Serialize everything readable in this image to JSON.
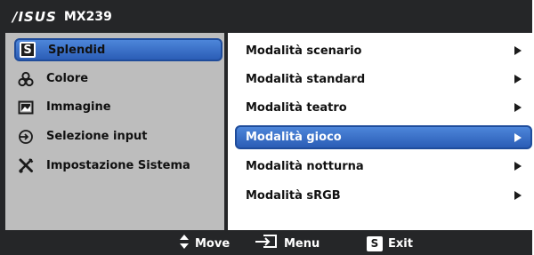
{
  "header": {
    "brand": "/ISUS",
    "model": "MX239"
  },
  "left_menu": {
    "items": [
      {
        "label": "Splendid",
        "icon": "splendid-s-icon",
        "selected": true
      },
      {
        "label": "Colore",
        "icon": "color-icon",
        "selected": false
      },
      {
        "label": "Immagine",
        "icon": "image-icon",
        "selected": false
      },
      {
        "label": "Selezione input",
        "icon": "input-select-icon",
        "selected": false
      },
      {
        "label": "Impostazione Sistema",
        "icon": "tools-icon",
        "selected": false
      }
    ]
  },
  "right_menu": {
    "items": [
      {
        "label": "Modalità scenario",
        "selected": false
      },
      {
        "label": "Modalità standard",
        "selected": false
      },
      {
        "label": "Modalità teatro",
        "selected": false
      },
      {
        "label": "Modalità gioco",
        "selected": true
      },
      {
        "label": "Modalità notturna",
        "selected": false
      },
      {
        "label": "Modalità sRGB",
        "selected": false
      }
    ]
  },
  "footer": {
    "move_label": "Move",
    "menu_label": "Menu",
    "exit_label": "Exit",
    "exit_key": "S"
  },
  "colors": {
    "frame": "#252628",
    "left_panel": "#bdbdbd",
    "right_panel": "#ffffff",
    "highlight": "#3b74d0"
  }
}
